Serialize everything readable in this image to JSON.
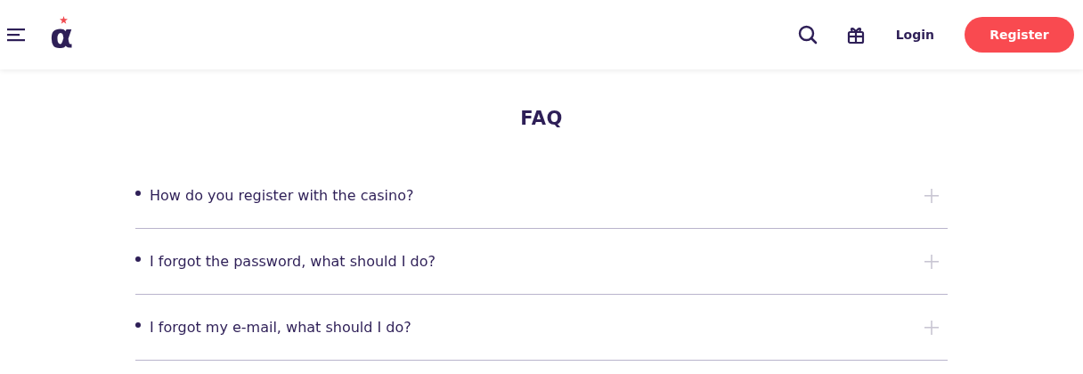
{
  "header": {
    "logo": "α",
    "login": "Login",
    "register": "Register"
  },
  "faq": {
    "title": "FAQ",
    "items": [
      {
        "question": "How do you register with the casino?",
        "expanded": false
      },
      {
        "question": "I forgot the password, what should I do?",
        "expanded": false
      },
      {
        "question": "I forgot my e-mail, what should I do?",
        "expanded": false
      }
    ]
  }
}
